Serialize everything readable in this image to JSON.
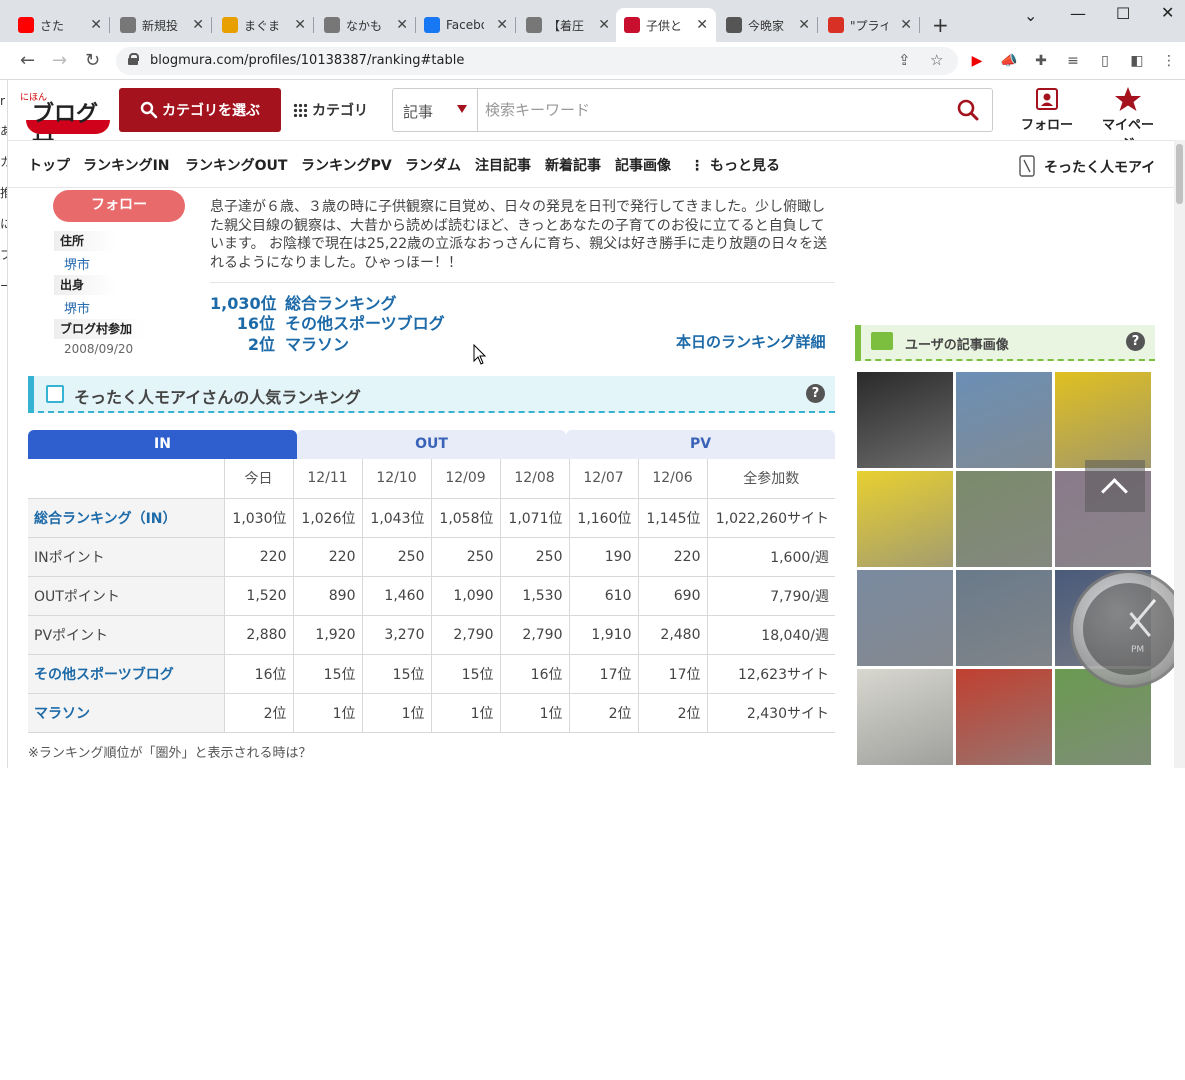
{
  "browser": {
    "tabs": [
      {
        "title": "さた",
        "icon": "youtube-icon",
        "color": "#ff0000"
      },
      {
        "title": "新規投",
        "icon": "page-icon",
        "color": "#777777"
      },
      {
        "title": "まぐまぐ",
        "icon": "mag-icon",
        "color": "#e8a000"
      },
      {
        "title": "なかも",
        "icon": "page-icon",
        "color": "#777777"
      },
      {
        "title": "Facebo",
        "icon": "facebook-icon",
        "color": "#1877f2"
      },
      {
        "title": "【着圧",
        "icon": "page-icon",
        "color": "#777777"
      },
      {
        "title": "子供と",
        "icon": "blogmura-icon",
        "color": "#c8102e"
      },
      {
        "title": "今晩家",
        "icon": "page-icon",
        "color": "#555555"
      },
      {
        "title": "\"プライ",
        "icon": "gmail-icon",
        "color": "#d93025"
      }
    ],
    "url": "blogmura.com/profiles/10138387/ranking#table"
  },
  "header": {
    "logo_small": "にほん",
    "logo_main": "ブログ村",
    "category_select_label": "カテゴリを選ぶ",
    "category_link_label": "カテゴリ",
    "search_type": "記事",
    "search_placeholder": "検索キーワード",
    "follow_label": "フォロー",
    "mypage_label": "マイページ"
  },
  "menu": {
    "items": [
      "トップ",
      "ランキングIN",
      "ランキングOUT",
      "ランキングPV",
      "ランダム",
      "注目記事",
      "新着記事",
      "記事画像",
      "もっと見る"
    ],
    "user_name": "そったく人モアイ"
  },
  "profile": {
    "follow_button": "フォロー",
    "address_label": "住所",
    "address_value": "堺市",
    "origin_label": "出身",
    "origin_value": "堺市",
    "joined_label": "ブログ村参加",
    "joined_value": "2008/09/20",
    "description": "息子達が６歳、３歳の時に子供観察に目覚め、日々の発見を日刊で発行してきました。少し俯瞰した親父目線の観察は、大昔から読めば読むほど、きっとあなたの子育てのお役に立てると自負しています。 お陰様で現在は25,22歳の立派なおっさんに育ち、親父は好き勝手に走り放題の日々を送れるようになりました。ひゃっほー！！",
    "rankings": [
      {
        "rank": "1,030位",
        "name": "総合ランキング"
      },
      {
        "rank": "16位",
        "name": "その他スポーツブログ"
      },
      {
        "rank": "2位",
        "name": "マラソン"
      }
    ],
    "rank_detail_link": "本日のランキング詳細"
  },
  "popular": {
    "title": "そったく人モアイさんの人気ランキング",
    "help": "?",
    "tabs": [
      "IN",
      "OUT",
      "PV"
    ],
    "columns": [
      "",
      "今日",
      "12/11",
      "12/10",
      "12/09",
      "12/08",
      "12/07",
      "12/06",
      "全参加数"
    ],
    "rows": [
      {
        "label": "総合ランキング（IN）",
        "link": true,
        "cells": [
          "1,030位",
          "1,026位",
          "1,043位",
          "1,058位",
          "1,071位",
          "1,160位",
          "1,145位",
          "1,022,260サイト"
        ]
      },
      {
        "label": "INポイント",
        "link": false,
        "cells": [
          "220",
          "220",
          "250",
          "250",
          "250",
          "190",
          "220",
          "1,600/週"
        ]
      },
      {
        "label": "OUTポイント",
        "link": false,
        "cells": [
          "1,520",
          "890",
          "1,460",
          "1,090",
          "1,530",
          "610",
          "690",
          "7,790/週"
        ]
      },
      {
        "label": "PVポイント",
        "link": false,
        "cells": [
          "2,880",
          "1,920",
          "3,270",
          "2,790",
          "2,790",
          "1,910",
          "2,480",
          "18,040/週"
        ]
      },
      {
        "label": "その他スポーツブログ",
        "link": true,
        "cells": [
          "16位",
          "15位",
          "15位",
          "15位",
          "16位",
          "17位",
          "17位",
          "12,623サイト"
        ]
      },
      {
        "label": "マラソン",
        "link": true,
        "cells": [
          "2位",
          "1位",
          "1位",
          "1位",
          "1位",
          "2位",
          "2位",
          "2,430サイト"
        ]
      }
    ],
    "note": "※ランキング順位が「圏外」と表示される時は？"
  },
  "images": {
    "title": "ユーザの記事画像",
    "help": "?",
    "thumb_colors": [
      "#2a2a2a",
      "#6b8fb5",
      "#e0c020",
      "#e8d030",
      "#7a8a6a",
      "#8a7a8a",
      "#7a8aa0",
      "#6a7a8a",
      "#4a5a7a",
      "#d8d8d0",
      "#c04030",
      "#6a9a50"
    ],
    "clock_label": "PM"
  },
  "left_strip": [
    "r",
    "あ",
    "カ",
    "推",
    "に",
    "ブ",
    "ー"
  ]
}
